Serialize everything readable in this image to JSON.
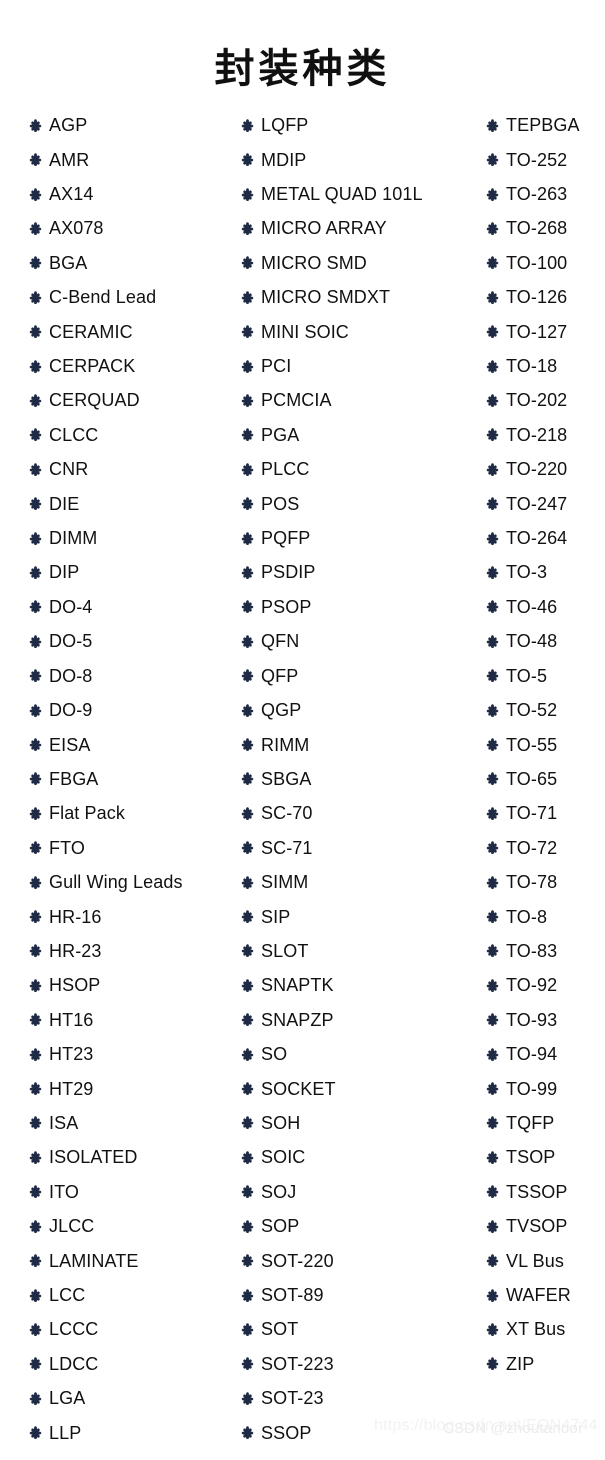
{
  "page": {
    "title": "封装种类",
    "background_color": "#ffffff",
    "text_color": "#111111",
    "bullet_color": "#1f2b45",
    "bullet_icon": "clover-bullet-icon"
  },
  "columns": [
    {
      "name": "column-1",
      "items": [
        "AGP",
        "AMR",
        "AX14",
        "AX078",
        "BGA",
        "C-Bend Lead",
        "CERAMIC",
        "CERPACK",
        "CERQUAD",
        "CLCC",
        "CNR",
        "DIE",
        "DIMM",
        "DIP",
        "DO-4",
        "DO-5",
        "DO-8",
        "DO-9",
        "EISA",
        "FBGA",
        "Flat Pack",
        "FTO",
        "Gull Wing Leads",
        "HR-16",
        "HR-23",
        "HSOP",
        "HT16",
        "HT23",
        "HT29",
        "ISA",
        "ISOLATED",
        "ITO",
        "JLCC",
        "LAMINATE",
        "LCC",
        "LCCC",
        "LDCC",
        "LGA",
        "LLP"
      ]
    },
    {
      "name": "column-2",
      "items": [
        "LQFP",
        "MDIP",
        "METAL QUAD 101L",
        "MICRO ARRAY",
        "MICRO SMD",
        "MICRO SMDXT",
        "MINI SOIC",
        "PCI",
        "PCMCIA",
        "PGA",
        "PLCC",
        "POS",
        "PQFP",
        "PSDIP",
        "PSOP",
        "QFN",
        "QFP",
        "QGP",
        "RIMM",
        "SBGA",
        "SC-70",
        "SC-71",
        "SIMM",
        "SIP",
        "SLOT",
        "SNAPTK",
        "SNAPZP",
        "SO",
        "SOCKET",
        "SOH",
        "SOIC",
        "SOJ",
        "SOP",
        "SOT-220",
        "SOT-89",
        "SOT",
        "SOT-223",
        "SOT-23",
        "SSOP"
      ]
    },
    {
      "name": "column-3",
      "items": [
        "TEPBGA",
        "TO-252",
        "TO-263",
        "TO-268",
        "TO-100",
        "TO-126",
        "TO-127",
        "TO-18",
        "TO-202",
        "TO-218",
        "TO-220",
        "TO-247",
        "TO-264",
        "TO-3",
        "TO-46",
        "TO-48",
        "TO-5",
        "TO-52",
        "TO-55",
        "TO-65",
        "TO-71",
        "TO-72",
        "TO-78",
        "TO-8",
        "TO-83",
        "TO-92",
        "TO-93",
        "TO-94",
        "TO-99",
        "TQFP",
        "TSOP",
        "TSSOP",
        "TVSOP",
        "VL Bus",
        "WAFER",
        "XT Bus",
        "ZIP"
      ]
    }
  ],
  "watermark": {
    "url": "https://blog.csdn.net/EQN4744",
    "handle": "CSDN @zhoutanooi"
  }
}
